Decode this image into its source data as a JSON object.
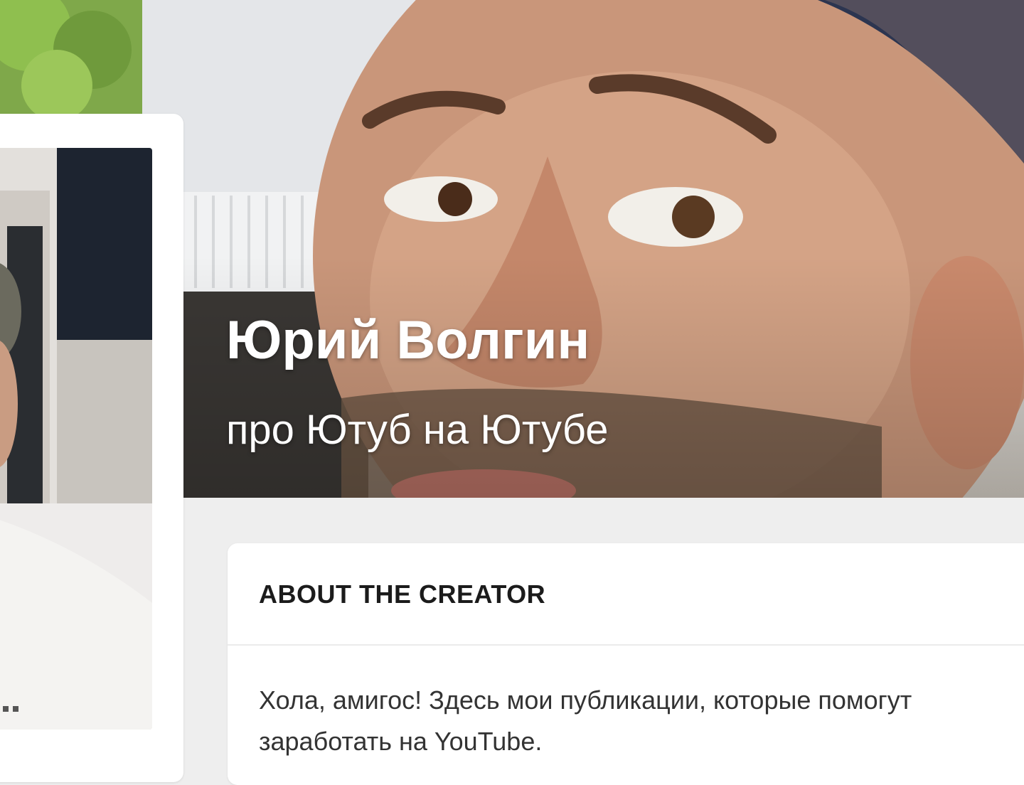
{
  "creator": {
    "name": "Юрий Волгин",
    "tagline": "про Ютуб на Ютубе"
  },
  "about": {
    "heading": "ABOUT THE CREATOR",
    "body": "Хола, амигос! Здесь мои публикации, которые помогут заработать на YouTube."
  },
  "colors": {
    "page_background": "#eeeeee",
    "card_background": "#ffffff",
    "heading_text": "#1b1b1b",
    "body_text": "#333333",
    "hero_text": "#ffffff"
  }
}
